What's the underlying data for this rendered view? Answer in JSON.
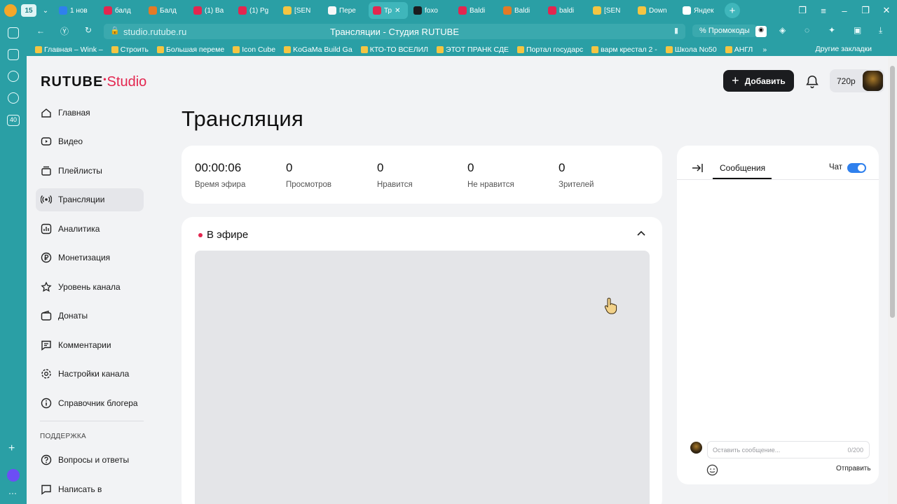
{
  "browser": {
    "tab_count": "15",
    "tabs": [
      {
        "label": "1 нов",
        "color": "#2f80ed"
      },
      {
        "label": "балд",
        "color": "#e3264f"
      },
      {
        "label": "Балд",
        "color": "#e37a26"
      },
      {
        "label": "(1) Ba",
        "color": "#e3264f"
      },
      {
        "label": "(1) Pg",
        "color": "#e3264f"
      },
      {
        "label": "[SEN",
        "color": "#f4c542"
      },
      {
        "label": "Пере",
        "color": "#f7f7f7"
      },
      {
        "label": "Тр",
        "color": "#e3264f",
        "active": true
      },
      {
        "label": "foxo",
        "color": "#1b1c1f"
      },
      {
        "label": "Baldi",
        "color": "#e3264f"
      },
      {
        "label": "Baldi",
        "color": "#e37a26"
      },
      {
        "label": "baldi",
        "color": "#e3264f"
      },
      {
        "label": "[SEN",
        "color": "#f4c542"
      },
      {
        "label": "Down",
        "color": "#f4c542"
      },
      {
        "label": "Яндек",
        "color": "#ffffff"
      }
    ],
    "url": "studio.rutube.ru",
    "page_title": "Трансляции - Студия RUTUBE",
    "promo_label": "Промокоды",
    "bookmarks": [
      "Главная – Wink –",
      "Строить",
      "Большая переме",
      "Icon Cube",
      "KoGaMa Build Ga",
      "КТО-ТО ВСЕЛИЛ",
      "ЭТОТ ПРАНК СДЕ",
      "Портал государс",
      "варм крестал 2 -",
      "Школа No50",
      "АНГЛ"
    ],
    "other_bookmarks": "Другие закладки",
    "strip_badge": "40"
  },
  "studio": {
    "logo_main": "RUTUBE",
    "logo_sub": "Studio",
    "add_label": "Добавить",
    "quality": "720p"
  },
  "nav": {
    "items": [
      {
        "label": "Главная",
        "icon": "home-icon"
      },
      {
        "label": "Видео",
        "icon": "video-icon"
      },
      {
        "label": "Плейлисты",
        "icon": "playlist-icon"
      },
      {
        "label": "Трансляции",
        "icon": "broadcast-icon"
      },
      {
        "label": "Аналитика",
        "icon": "analytics-icon"
      },
      {
        "label": "Монетизация",
        "icon": "ruble-icon"
      },
      {
        "label": "Уровень канала",
        "icon": "star-icon"
      },
      {
        "label": "Донаты",
        "icon": "wallet-icon"
      },
      {
        "label": "Комментарии",
        "icon": "comment-icon"
      },
      {
        "label": "Настройки канала",
        "icon": "gear-icon"
      },
      {
        "label": "Справочник блогера",
        "icon": "info-icon"
      }
    ],
    "support_label": "ПОДДЕРЖКА",
    "support_items": [
      {
        "label": "Вопросы и ответы",
        "icon": "question-icon"
      },
      {
        "label": "Написать в",
        "icon": "chat-icon"
      }
    ]
  },
  "main": {
    "title": "Трансляция",
    "stats": [
      {
        "value": "00:00:06",
        "label": "Время эфира"
      },
      {
        "value": "0",
        "label": "Просмотров"
      },
      {
        "value": "0",
        "label": "Нравится"
      },
      {
        "value": "0",
        "label": "Не нравится"
      },
      {
        "value": "0",
        "label": "Зрителей"
      }
    ],
    "live_title": "В эфире"
  },
  "chat": {
    "tab_label": "Сообщения",
    "toggle_label": "Чат",
    "toggle_on": true,
    "input_placeholder": "Оставить сообщение...",
    "char_count": "0/200",
    "send_label": "Отправить"
  }
}
